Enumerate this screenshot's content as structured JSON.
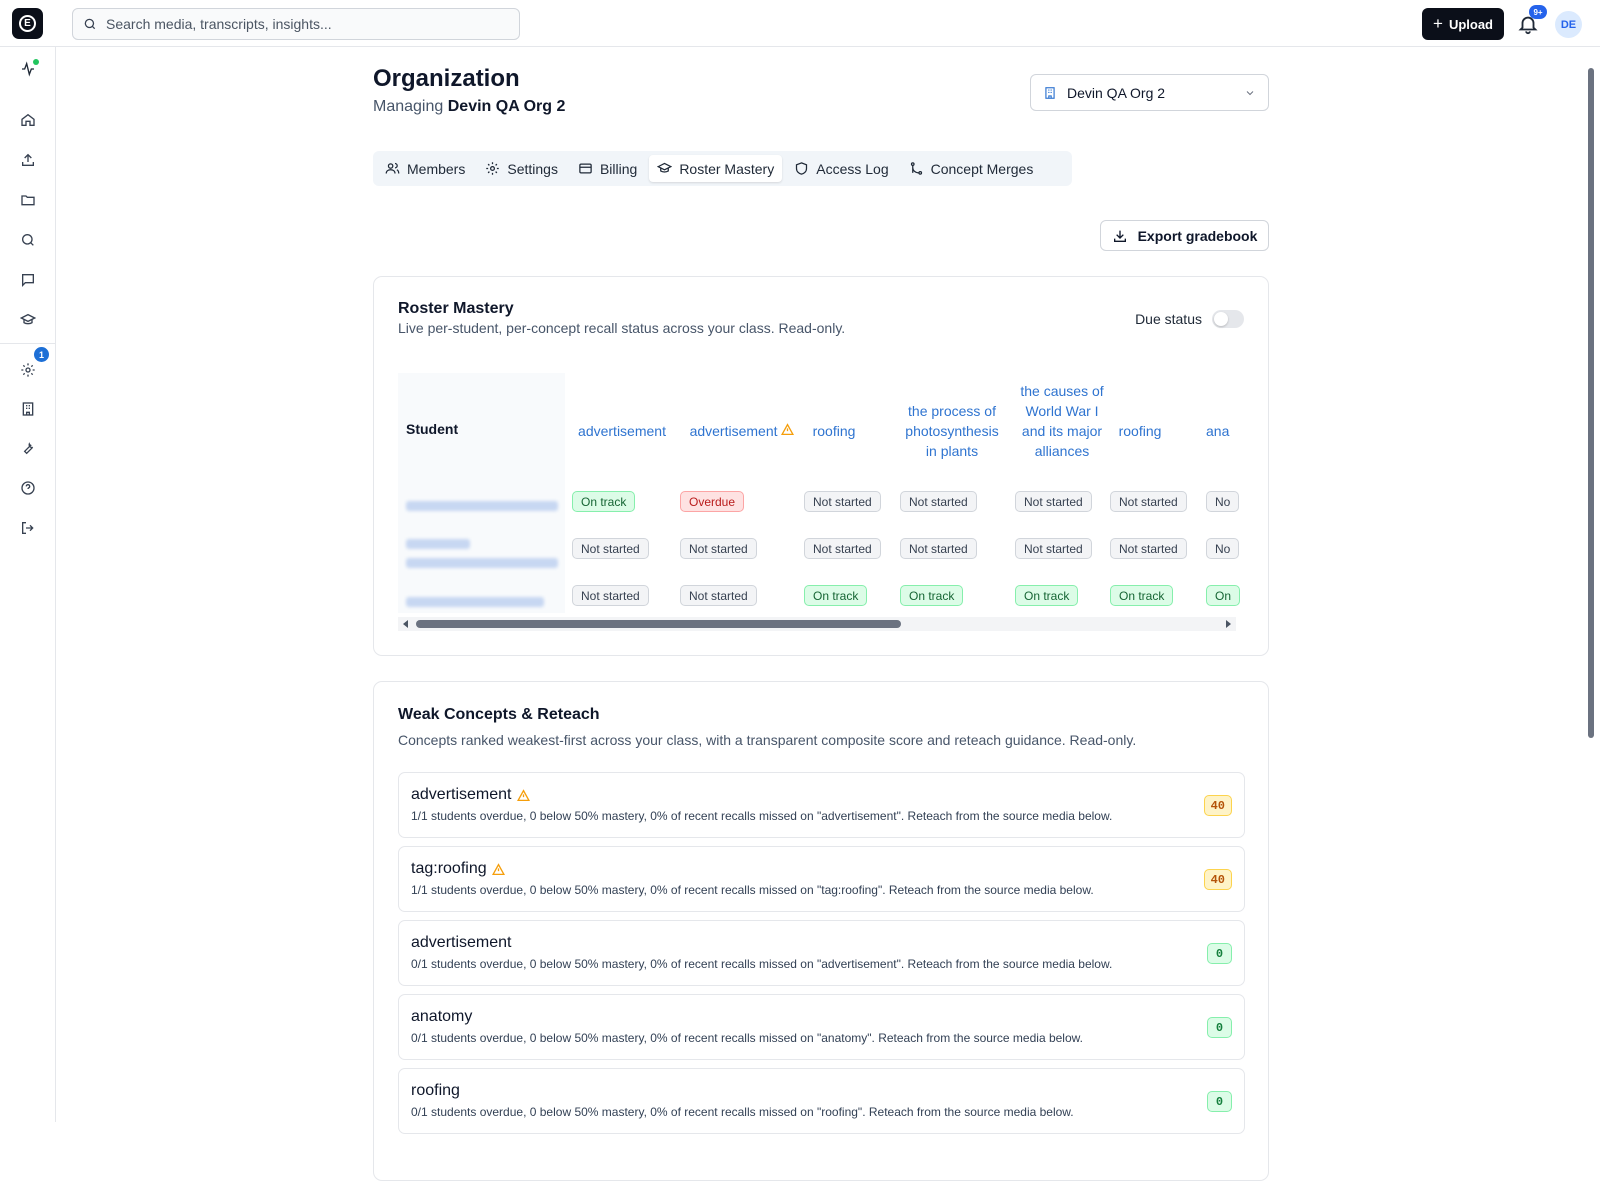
{
  "topbar": {
    "logo_letter": "E",
    "search_placeholder": "Search media, transcripts, insights...",
    "upload_label": "Upload",
    "notifications_badge": "9+",
    "avatar_initials": "DE"
  },
  "sidebar": {
    "items": [
      "activity-icon",
      "home-icon",
      "upload-icon",
      "folder-icon",
      "search-icon",
      "chat-icon",
      "graduation-cap-icon",
      "gear-icon",
      "building-icon",
      "wrench-icon",
      "help-icon",
      "logout-icon"
    ],
    "learning_badge": "1"
  },
  "header": {
    "title": "Organization",
    "managing_prefix": "Managing",
    "org_name": "Devin QA Org 2",
    "org_select_value": "Devin QA Org 2"
  },
  "tabs": [
    {
      "label": "Members",
      "icon": "users-icon"
    },
    {
      "label": "Settings",
      "icon": "gear-icon"
    },
    {
      "label": "Billing",
      "icon": "card-icon"
    },
    {
      "label": "Roster Mastery",
      "icon": "graduation-cap-icon",
      "active": true
    },
    {
      "label": "Access Log",
      "icon": "shield-icon"
    },
    {
      "label": "Concept Merges",
      "icon": "merge-icon"
    }
  ],
  "export_label": "Export gradebook",
  "roster": {
    "title": "Roster Mastery",
    "subtitle": "Live per-student, per-concept recall status across your class. Read-only.",
    "due_status_label": "Due status",
    "student_header": "Student",
    "columns": [
      "advertisement",
      "advertisement",
      "roofing",
      "the process of photosynthesis in plants",
      "the causes of World War I and its major alliances",
      "roofing",
      "ana"
    ],
    "rows": [
      [
        "On track",
        "Overdue",
        "Not started",
        "Not started",
        "Not started",
        "Not started",
        "No"
      ],
      [
        "Not started",
        "Not started",
        "Not started",
        "Not started",
        "Not started",
        "Not started",
        "No"
      ],
      [
        "Not started",
        "Not started",
        "On track",
        "On track",
        "On track",
        "On track",
        "On"
      ]
    ]
  },
  "weak": {
    "title": "Weak Concepts & Reteach",
    "subtitle": "Concepts ranked weakest-first across your class, with a transparent composite score and reteach guidance. Read-only.",
    "concepts": [
      {
        "name": "advertisement",
        "warning": true,
        "desc": "1/1 students overdue, 0 below 50% mastery, 0% of recent recalls missed on \"advertisement\". Reteach from the source media below.",
        "score": "40"
      },
      {
        "name": "tag:roofing",
        "warning": true,
        "desc": "1/1 students overdue, 0 below 50% mastery, 0% of recent recalls missed on \"tag:roofing\". Reteach from the source media below.",
        "score": "40"
      },
      {
        "name": "advertisement",
        "warning": false,
        "desc": "0/1 students overdue, 0 below 50% mastery, 0% of recent recalls missed on \"advertisement\". Reteach from the source media below.",
        "score": "0"
      },
      {
        "name": "anatomy",
        "warning": false,
        "desc": "0/1 students overdue, 0 below 50% mastery, 0% of recent recalls missed on \"anatomy\". Reteach from the source media below.",
        "score": "0"
      },
      {
        "name": "roofing",
        "warning": false,
        "desc": "0/1 students overdue, 0 below 50% mastery, 0% of recent recalls missed on \"roofing\". Reteach from the source media below.",
        "score": "0"
      }
    ]
  },
  "colors": {
    "accent": "#2f74d0",
    "on_track": "#166534",
    "overdue": "#b91c1c",
    "warning": "#f59e0b"
  }
}
